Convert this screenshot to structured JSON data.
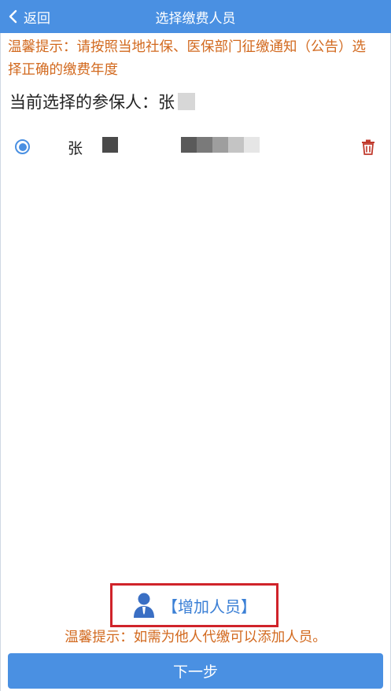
{
  "header": {
    "back_label": "返回",
    "title": "选择缴费人员"
  },
  "notice": {
    "text": "温馨提示：请按照当地社保、医保部门征缴通知（公告）选择正确的缴费年度"
  },
  "current": {
    "label": "当前选择的参保人：张"
  },
  "persons": [
    {
      "name": "张",
      "selected": true
    }
  ],
  "add": {
    "label": "【增加人员】"
  },
  "hint": {
    "text": "温馨提示：如需为他人代缴可以添加人员。"
  },
  "footer": {
    "next_label": "下一步"
  },
  "colors": {
    "primary": "#4a90e2",
    "notice": "#d2691e",
    "highlight_border": "#d0232a",
    "delete": "#c0392b"
  }
}
